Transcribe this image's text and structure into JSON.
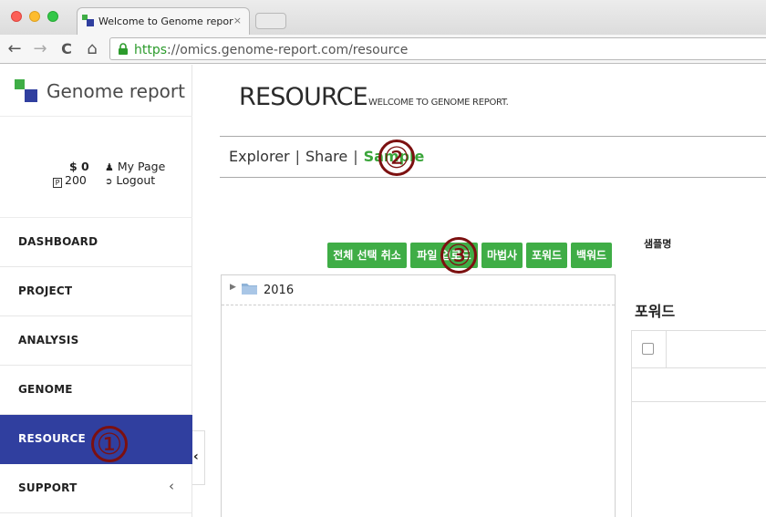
{
  "browser": {
    "tab_title": "Welcome to Genome repor",
    "tab_close": "×",
    "url_scheme": "https",
    "url_rest": "://omics.genome-report.com/resource",
    "back_icon": "←",
    "forward_icon": "→",
    "reload_icon": "C",
    "home_icon": "⌂"
  },
  "sidebar": {
    "logo_text": "Genome report",
    "account": {
      "balance": "$ 0",
      "points": "200",
      "my_page": "My Page",
      "logout": "Logout"
    },
    "items": [
      {
        "label": "DASHBOARD"
      },
      {
        "label": "PROJECT"
      },
      {
        "label": "ANALYSIS"
      },
      {
        "label": "GENOME"
      },
      {
        "label": "RESOURCE"
      },
      {
        "label": "SUPPORT",
        "chevron": "‹"
      }
    ],
    "collapse_icon": "‹"
  },
  "header": {
    "title": "RESOURCE",
    "subtitle": "WELCOME TO GENOME REPORT."
  },
  "breadcrumbs": {
    "explorer": "Explorer",
    "share": "Share",
    "sample": "Sample",
    "separator": "|"
  },
  "actions": [
    {
      "label": "전체 선택 취소"
    },
    {
      "label": "파일 업로드"
    },
    {
      "label": "마법사"
    },
    {
      "label": "포워드"
    },
    {
      "label": "백워드"
    }
  ],
  "tree": {
    "arrow": "▶",
    "items": [
      {
        "label": "2016"
      }
    ]
  },
  "right_panel": {
    "sample_name_label": "샘플명",
    "forward_title": "포워드"
  },
  "callouts": [
    "①",
    "②",
    "③"
  ],
  "colors": {
    "accent_green": "#3fad46",
    "active_nav": "#303f9f",
    "callout": "#7c1010"
  }
}
